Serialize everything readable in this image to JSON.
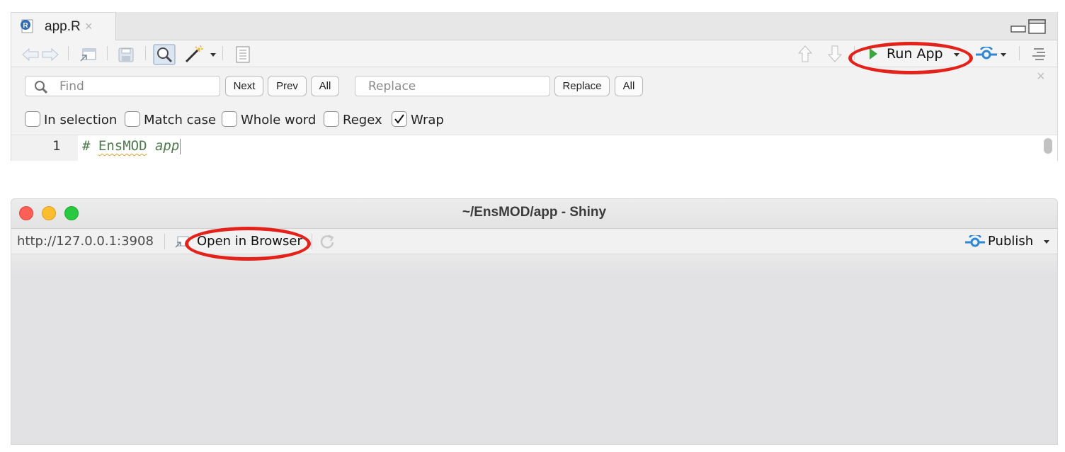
{
  "editor": {
    "tab": {
      "label": "app.R",
      "close_glyph": "×",
      "badge_letter": "R"
    },
    "toolbar": {
      "run_app_label": "Run App",
      "icons": [
        "back-arrow-icon",
        "forward-arrow-icon",
        "show-in-window-icon",
        "save-icon",
        "find-replace-icon",
        "magic-wand-icon",
        "dropdown-arrow-icon",
        "compile-report-icon",
        "up-arrow-icon",
        "down-arrow-icon",
        "run-icon",
        "publish-icon",
        "outline-icon"
      ]
    },
    "find": {
      "find_placeholder": "Find",
      "next_label": "Next",
      "prev_label": "Prev",
      "all_label": "All",
      "replace_placeholder": "Replace",
      "replace_label": "Replace",
      "replace_all_label": "All",
      "close_glyph": "×"
    },
    "options": {
      "in_selection": "In selection",
      "match_case": "Match case",
      "whole_word": "Whole word",
      "regex": "Regex",
      "wrap": "Wrap",
      "wrap_checked": true
    },
    "code": {
      "line_number": "1",
      "comment_prefix": "# ",
      "comment_word1": "EnsMOD",
      "comment_word2": " app"
    }
  },
  "viewer": {
    "title": "~/EnsMOD/app - Shiny",
    "url": "http://127.0.0.1:3908",
    "open_in_browser_label": "Open in Browser",
    "publish_label": "Publish"
  },
  "colors": {
    "annotation_ring": "#e3231b",
    "run_green": "#3ea346",
    "publish_blue": "#2f86d4",
    "close_red": "#fe5f57",
    "minimize_yellow": "#febc2e",
    "zoom_green": "#28c840",
    "comment_green": "#4e7a4d"
  }
}
